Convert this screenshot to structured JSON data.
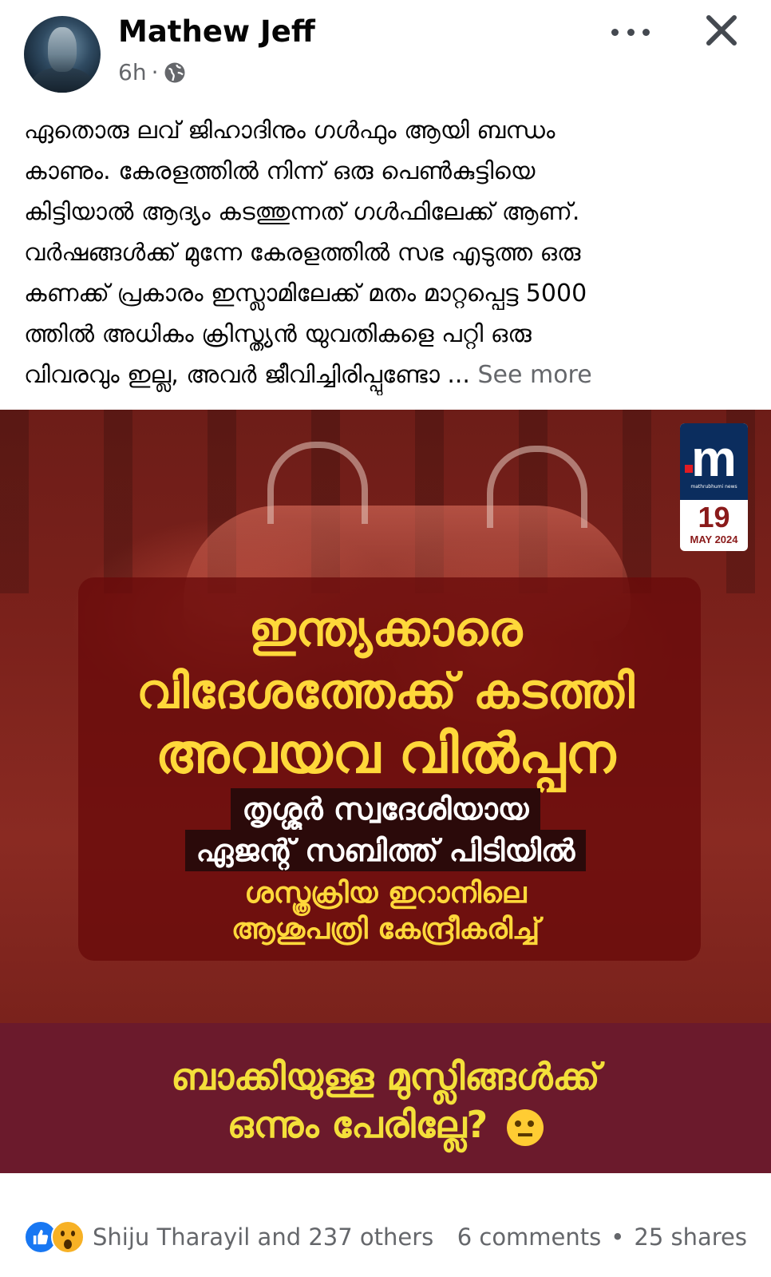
{
  "post": {
    "author": "Mathew Jeff",
    "time": "6h",
    "separator": "·",
    "text_lines": [
      "ഏതൊരു ലവ് ജിഹാദിനും ഗൾഫും ആയി ബന്ധം",
      "കാണും. കേരളത്തിൽ നിന്ന് ഒരു പെൺകുട്ടിയെ",
      "കിട്ടിയാൽ ആദ്യം കടത്തുന്നത് ഗൾഫിലേക്ക് ആണ്.",
      "വർഷങ്ങൾക്ക് മുന്നേ കേരളത്തിൽ സഭ എടുത്ത ഒരു",
      "കണക്ക് പ്രകാരം ഇസ്ലാമിലേക്ക് മതം മാറ്റപ്പെട്ട 5000",
      "ത്തിൽ അധികം ക്രിസ്ത്യൻ യുവതികളെ പറ്റി ഒരു",
      "വിവരവും ഇല്ല, അവർ ജീവിച്ചിരിപ്പുണ്ടോ ..."
    ],
    "see_more": "See more"
  },
  "media": {
    "logo_date_day": "19",
    "logo_date_month": "MAY 2024",
    "logo_subtext": "mathrubhumi news",
    "headline": [
      "ഇന്ത്യക്കാരെ",
      "വിദേശത്തേക്ക് കടത്തി",
      "അവയവ വിൽപ്പന",
      "തൃശ്ശൂർ സ്വദേശിയായ",
      "ഏജന്റ് സബിത്ത് പിടിയിൽ",
      "ശസ്ത്രക്രിയ ഇറാനിലെ",
      "ആശുപത്രി കേന്ദ്രീകരിച്ച്"
    ],
    "caption": [
      "ബാക്കിയുള്ള മുസ്ലിങ്ങൾക്ക്",
      "ഒന്നും പേരില്ലേ?"
    ]
  },
  "footer": {
    "reactors": "Shiju Tharayil and 237 others",
    "comments": "6 comments",
    "dot": "•",
    "shares": "25 shares"
  },
  "icons": [
    "globe-icon",
    "more-icon",
    "close-icon",
    "like-icon",
    "wow-icon",
    "thinking-emoji-icon"
  ]
}
